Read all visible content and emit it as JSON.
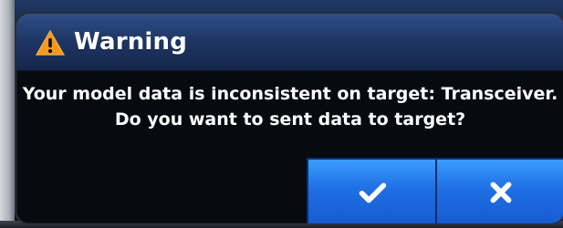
{
  "dialog": {
    "title": "Warning",
    "message_lines": [
      "Your model data is inconsistent on target: Transceiver.",
      "Do you want to sent data to target?"
    ],
    "icons": {
      "title_icon": "warning-icon",
      "confirm_icon": "check-icon",
      "cancel_icon": "close-icon"
    },
    "colors": {
      "titlebar": "#1f3766",
      "dialog_bg": "#070a0f",
      "button": "#1f6fe3",
      "text": "#ffffff",
      "warning": "#f39a1d"
    }
  }
}
